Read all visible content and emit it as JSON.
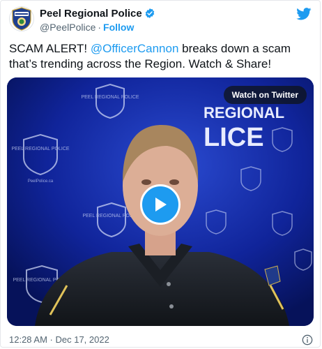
{
  "author": {
    "display_name": "Peel Regional Police",
    "handle": "@PeelPolice",
    "separator": "·",
    "follow_label": "Follow"
  },
  "tweet": {
    "text_before": "SCAM ALERT!  ",
    "mention": "@OfficerCannon",
    "text_after": " breaks down a scam that’s trending across the Region. Watch & Share!"
  },
  "media": {
    "watch_label": "Watch on Twitter",
    "backdrop_text_line1": "REGIONAL",
    "backdrop_text_line2": "LICE",
    "badge_text": "PEEL REGIONAL POLICE",
    "url_text": "PeelPolice.ca"
  },
  "footer": {
    "timestamp": "12:28 AM · Dec 17, 2022"
  },
  "colors": {
    "accent": "#1d9bf0",
    "backdrop": "#0a1e86"
  },
  "icons": {
    "verified": "verified-badge-icon",
    "brand": "twitter-bird-icon",
    "play": "play-icon",
    "info": "info-icon"
  }
}
